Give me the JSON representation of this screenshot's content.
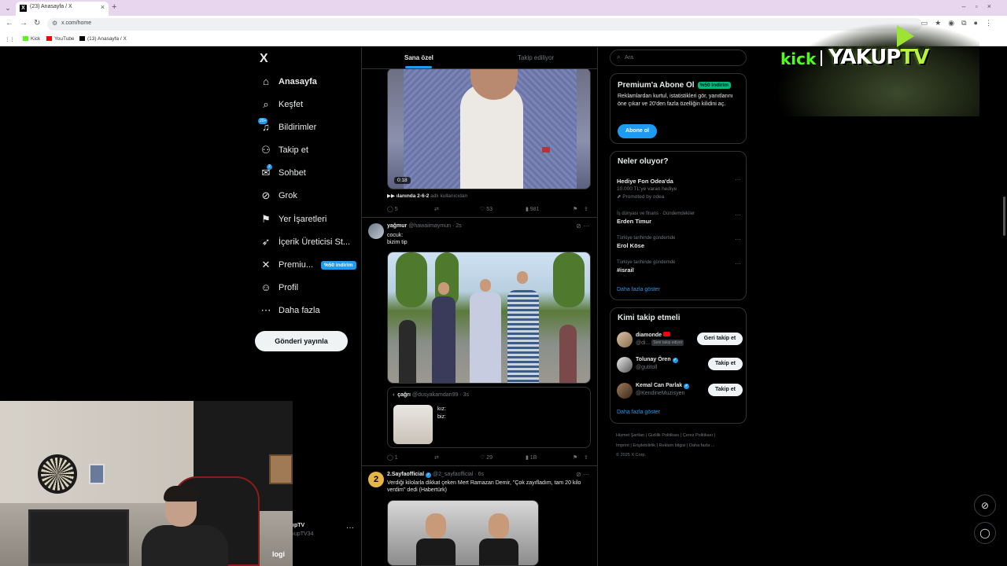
{
  "browser": {
    "tab_title": "(23) Anasayfa / X",
    "tab_favicon": "X",
    "new_tab_symbol": "+",
    "url": "x.com/home",
    "bookmarks": [
      {
        "label": "Kick",
        "color": "#53fc18"
      },
      {
        "label": "YouTube",
        "color": "#ff0000"
      },
      {
        "label": "(13) Anasayfa / X",
        "color": "#000000"
      }
    ]
  },
  "nav": {
    "logo": "X",
    "items": [
      {
        "label": "Anasayfa",
        "icon": "home-icon",
        "glyph": "⌂",
        "active": true
      },
      {
        "label": "Keşfet",
        "icon": "search-icon",
        "glyph": "⌕"
      },
      {
        "label": "Bildirimler",
        "icon": "bell-icon",
        "glyph": "♫",
        "badge": "20+"
      },
      {
        "label": "Takip et",
        "icon": "person-add-icon",
        "glyph": "⚇"
      },
      {
        "label": "Sohbet",
        "icon": "mail-icon",
        "glyph": "✉",
        "badge": "2"
      },
      {
        "label": "Grok",
        "icon": "grok-icon",
        "glyph": "⊘"
      },
      {
        "label": "Yer İşaretleri",
        "icon": "bookmark-icon",
        "glyph": "⚑"
      },
      {
        "label": "İçerik Üreticisi St...",
        "icon": "rocket-icon",
        "glyph": "➶"
      },
      {
        "label": "Premiu...",
        "icon": "x-premium-icon",
        "glyph": "✕",
        "promo": "%50 indirim"
      },
      {
        "label": "Profil",
        "icon": "profile-icon",
        "glyph": "☺"
      },
      {
        "label": "Daha fazla",
        "icon": "more-circle-icon",
        "glyph": "⋯"
      }
    ],
    "post_button": "Gönderi yayınla",
    "account_name": "ıpTV",
    "account_handle": "ıupTV34",
    "account_more": "···"
  },
  "feed": {
    "tabs": [
      "Sana özel",
      "Takip ediliyor"
    ],
    "post0": {
      "duration": "0:18",
      "caption": "ılanında 2-6-2",
      "caption_dim": "adlı kullanıcıdan",
      "stats": {
        "reply": "5",
        "repost": "",
        "like": "53",
        "views": "981"
      }
    },
    "post1": {
      "name": "yağmur",
      "handle": "@hawaiimaymun · 2s",
      "text_line1": "cocuk:",
      "text_line2": "bizim tip",
      "quote": {
        "name": "çağrı",
        "handle": "@dusyakamdan99 · 3s",
        "line1": "kız:",
        "line2": "biz:"
      },
      "stats": {
        "reply": "1",
        "repost": "",
        "like": "29",
        "views": "1B"
      }
    },
    "post2": {
      "name": "2.Sayfaofficial",
      "handle": "@2_sayfaofficial · 6s",
      "text": "Verdiği kilolarla dikkat çeken Mert Ramazan Demir, \"Çok zayıfladım, tam 20 kilo verdim\" dedi (Habertürk)",
      "avatar_text": "2"
    }
  },
  "sidebar": {
    "search_placeholder": "Ara",
    "premium": {
      "title": "Premium'a Abone Ol",
      "badge": "%50 indirim",
      "body": "Reklamlardan kurtul, istatistikleri gör, yanıtlarını öne çıkar ve 20'den fazla özelliğin kilidini aç.",
      "button": "Abone ol"
    },
    "trends": {
      "title": "Neler oluyor?",
      "items": [
        {
          "context": "",
          "name": "Hediye Fon Odea'da",
          "sub": "10.000 TL'ye varan hediye",
          "promoted": "Promoted by odea"
        },
        {
          "context": "İş dünyası ve finans · Gündemdekiler",
          "name": "Erden Timur",
          "sub": ""
        },
        {
          "context": "Türkiye tarihinde gündemde",
          "name": "Erol Köse",
          "sub": ""
        },
        {
          "context": "Türkiye tarihinde gündemde",
          "name": "#israil",
          "sub": ""
        }
      ],
      "show_more": "Daha fazla göster"
    },
    "who_to_follow": {
      "title": "Kimi takip etmeli",
      "items": [
        {
          "name": "diamonde",
          "handle": "@di...",
          "tag": "Seni takip ediyor",
          "button": "Geri takip et",
          "mark": "youtube"
        },
        {
          "name": "Tolunay Ören",
          "handle": "@gutitoll",
          "button": "Takip et",
          "mark": "verified"
        },
        {
          "name": "Kemal Can Parlak",
          "handle": "@KendineMuzisyen",
          "button": "Takip et",
          "mark": "verified"
        }
      ],
      "show_more": "Daha fazla göster"
    },
    "footer": [
      "Hizmet Şartları",
      "Gizlilik Politikası",
      "Çerez Politikası",
      "Imprint",
      "Erişilebilirlik",
      "Reklam bilgisi",
      "Daha fazla ...",
      "© 2025 X Corp."
    ]
  },
  "overlay": {
    "kick": "kick",
    "brand_main": "YAKUP",
    "brand_accent": "TV",
    "logi": "logi"
  },
  "colors": {
    "accent": "#1d9bf0",
    "kick": "#53fc18",
    "success": "#00ba7c"
  }
}
